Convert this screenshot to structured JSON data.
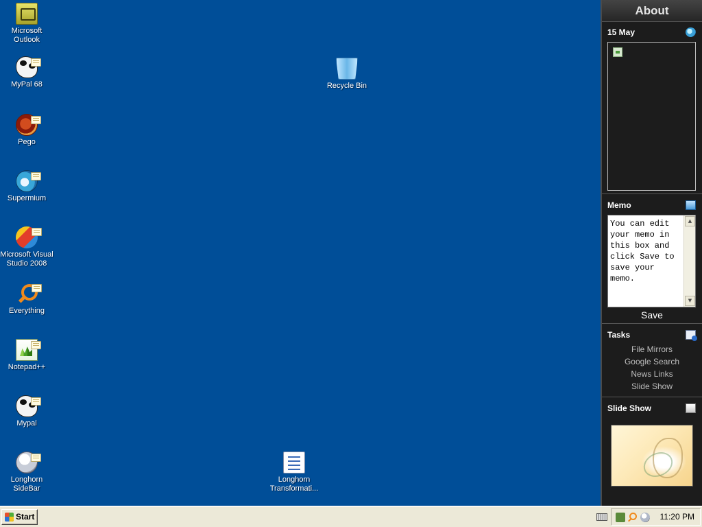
{
  "desktop": {
    "background": "#004e98",
    "icons": [
      {
        "label": "Microsoft Outlook"
      },
      {
        "label": "MyPal 68"
      },
      {
        "label": "Pego"
      },
      {
        "label": "Supermium"
      },
      {
        "label": "Microsoft Visual Studio 2008"
      },
      {
        "label": "Everything"
      },
      {
        "label": "Notepad++"
      },
      {
        "label": "Mypal"
      },
      {
        "label": "Longhorn SideBar"
      },
      {
        "label": "Recycle Bin"
      },
      {
        "label": "Longhorn Transformati..."
      }
    ]
  },
  "sidebar": {
    "title": "About",
    "calendar": {
      "date": "15 May"
    },
    "memo": {
      "heading": "Memo",
      "text": "You can edit your memo in this box and click Save to save your memo.",
      "save_label": "Save"
    },
    "tasks": {
      "heading": "Tasks",
      "items": [
        "File Mirrors",
        "Google Search",
        "News Links",
        "Slide Show"
      ]
    },
    "slideshow": {
      "heading": "Slide Show"
    }
  },
  "taskbar": {
    "start_label": "Start",
    "clock": "11:20 PM"
  }
}
